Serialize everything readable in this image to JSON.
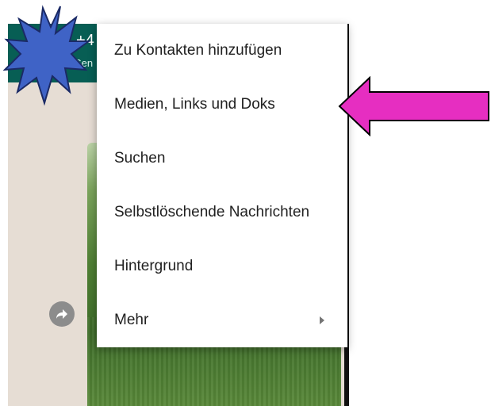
{
  "chat_header": {
    "title_fragment": "+4",
    "subtitle_fragment": "Sen"
  },
  "menu": {
    "items": [
      {
        "label": "Zu Kontakten hinzufügen",
        "has_submenu": false
      },
      {
        "label": "Medien, Links und Doks",
        "has_submenu": false
      },
      {
        "label": "Suchen",
        "has_submenu": false
      },
      {
        "label": "Selbstlöschende Nachrichten",
        "has_submenu": false
      },
      {
        "label": "Hintergrund",
        "has_submenu": false
      },
      {
        "label": "Mehr",
        "has_submenu": true
      }
    ]
  },
  "annotations": {
    "starburst_color": "#3f63c6",
    "arrow_color": "#e62ec1",
    "highlighted_item": "Medien, Links und Doks"
  },
  "colors": {
    "appbar": "#075e54",
    "menu_background": "#ffffff",
    "menu_text": "#212121"
  }
}
